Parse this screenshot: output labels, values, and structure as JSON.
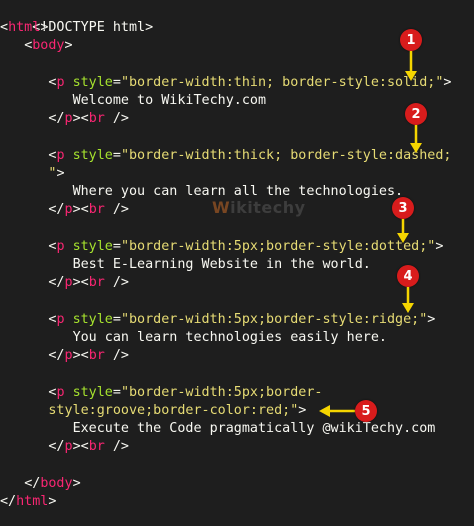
{
  "code": {
    "doctype": "<!DOCTYPE html>",
    "html_open": "html",
    "body_open": "body",
    "p": "p",
    "br": "br",
    "style_attr": "style",
    "blocks": [
      {
        "style_line1": "\"border-width:thin; border-style:solid;\"",
        "style_line2": "",
        "text": "Welcome to WikiTechy.com"
      },
      {
        "style_line1": "\"border-width:thick; border-style:dashed;",
        "style_line2": "\"",
        "text": "Where you can learn all the technologies."
      },
      {
        "style_line1": "\"border-width:5px;border-style:dotted;\"",
        "style_line2": "",
        "text": "Best E-Learning Website in the world."
      },
      {
        "style_line1": "\"border-width:5px;border-style:ridge;\"",
        "style_line2": "",
        "text": "You can learn technologies easily here."
      },
      {
        "style_line1": "\"border-width:5px;border-",
        "style_line2": "style:groove;border-color:red;\"",
        "text": "Execute the Code pragmatically @wikiTechy.com"
      }
    ],
    "body_close": "body",
    "html_close": "html"
  },
  "markers": [
    "1",
    "2",
    "3",
    "4",
    "5"
  ],
  "watermark": {
    "w": "W",
    "rest": "ikitechy"
  },
  "colors": {
    "background": "#1e1e1e",
    "tag": "#f92672",
    "attribute": "#a6e22e",
    "string": "#e6db74",
    "text": "#f8f8f2",
    "marker": "#d81c1c",
    "arrow": "#f5d500"
  }
}
